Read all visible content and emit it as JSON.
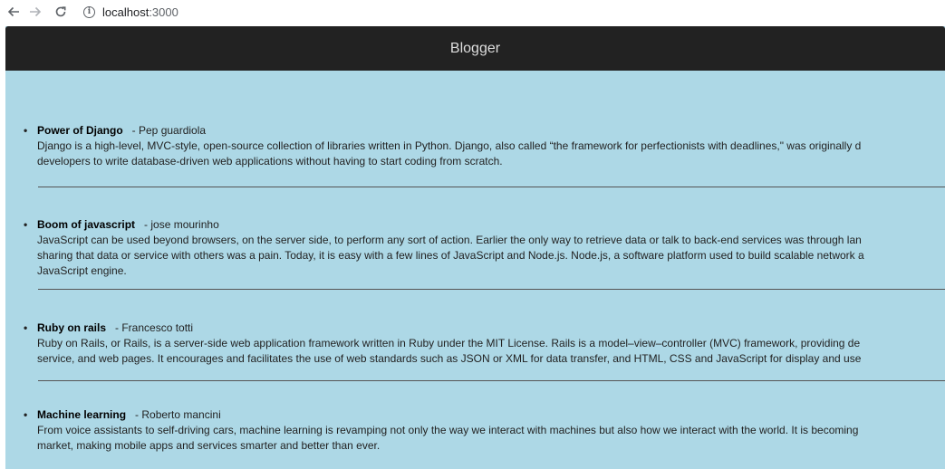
{
  "browser": {
    "url_host": "localhost",
    "url_port": ":3000"
  },
  "header": {
    "title": "Blogger"
  },
  "posts": [
    {
      "title": "Power of Django",
      "author": "- Pep guardiola",
      "lines": [
        "Django is a high-level, MVC-style, open-source collection of libraries written in Python. Django, also called “the framework for perfectionists with deadlines,\" was originally d",
        "developers to write database-driven web applications without having to start coding from scratch."
      ]
    },
    {
      "title": "Boom of javascript",
      "author": "- jose mourinho",
      "lines": [
        "JavaScript can be used beyond browsers, on the server side, to perform any sort of action. Earlier the only way to retrieve data or talk to back-end services was through lan",
        "sharing that data or service with others was a pain. Today, it is easy with a few lines of JavaScript and Node.js. Node.js, a software platform used to build scalable network a",
        "JavaScript engine."
      ]
    },
    {
      "title": "Ruby on rails",
      "author": "- Francesco totti",
      "lines": [
        "Ruby on Rails, or Rails, is a server-side web application framework written in Ruby under the MIT License. Rails is a model–view–controller (MVC) framework, providing de",
        "service, and web pages. It encourages and facilitates the use of web standards such as JSON or XML for data transfer, and HTML, CSS and JavaScript for display and use"
      ]
    },
    {
      "title": "Machine learning",
      "author": "- Roberto mancini",
      "lines": [
        "From voice assistants to self-driving cars, machine learning is revamping not only the way we interact with machines but also how we interact with the world. It is becoming",
        "market, making mobile apps and services smarter and better than ever."
      ]
    }
  ]
}
